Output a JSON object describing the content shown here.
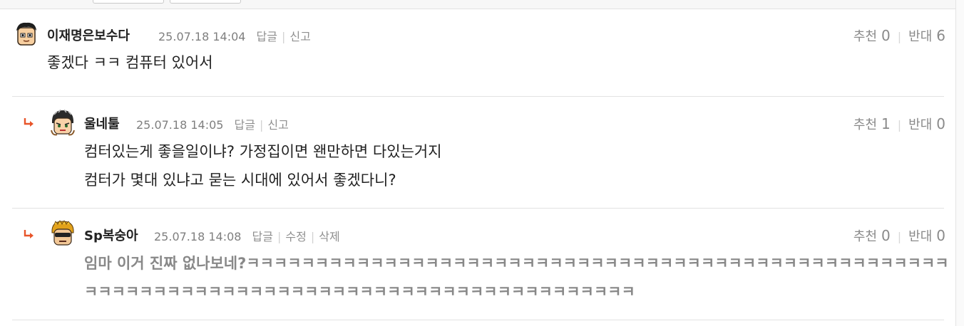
{
  "comments": [
    {
      "author": "이재명은보수다",
      "date": "25.07.18 14:04",
      "actions": [
        "답글",
        "신고"
      ],
      "votes": {
        "up_label": "추천",
        "up": "0",
        "down_label": "반대",
        "down": "6"
      },
      "lines": [
        "좋겠다 ㅋㅋ 컴퓨터 있어서"
      ],
      "is_reply": false
    },
    {
      "author": "울네툴",
      "date": "25.07.18 14:05",
      "actions": [
        "답글",
        "신고"
      ],
      "votes": {
        "up_label": "추천",
        "up": "1",
        "down_label": "반대",
        "down": "0"
      },
      "lines": [
        "컴터있는게 좋을일이냐? 가정집이면 왠만하면 다있는거지",
        "컴터가 몇대 있냐고 묻는 시대에 있어서 좋겠다니?"
      ],
      "is_reply": true
    },
    {
      "author": "Sp복숭아",
      "date": "25.07.18 14:08",
      "actions": [
        "답글",
        "수정",
        "삭제"
      ],
      "votes": {
        "up_label": "추천",
        "up": "0",
        "down_label": "반대",
        "down": "0"
      },
      "lines": [
        "임마 이거 진짜 없나보네?ㅋㅋㅋㅋㅋㅋㅋㅋㅋㅋㅋㅋㅋㅋㅋㅋㅋㅋㅋㅋㅋㅋㅋㅋㅋㅋㅋㅋㅋㅋㅋㅋㅋㅋㅋㅋㅋㅋㅋㅋㅋㅋㅋㅋㅋㅋㅋㅋㅋㅋㅋ",
        "ㅋㅋㅋㅋㅋㅋㅋㅋㅋㅋㅋㅋㅋㅋㅋㅋㅋㅋㅋㅋㅋㅋㅋㅋㅋㅋㅋㅋㅋㅋㅋㅋㅋㅋㅋㅋㅋㅋㅋㅋ"
      ],
      "is_reply": true
    }
  ],
  "colors": {
    "reply_arrow": "#e8552a",
    "muted": "#8a8a8a",
    "text": "#222222"
  },
  "icons": {
    "reply": "reply-arrow-icon",
    "avatar": "avatar-icon"
  }
}
